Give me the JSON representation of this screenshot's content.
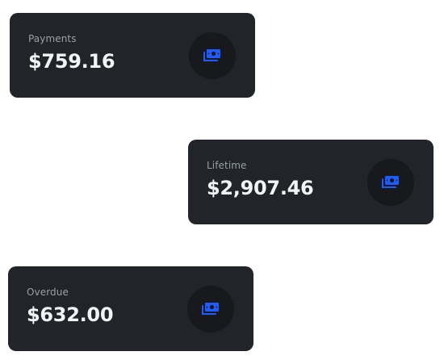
{
  "accent": "#1f5cff",
  "cards": [
    {
      "label": "Payments",
      "value": "$759.16",
      "icon": "money-icon"
    },
    {
      "label": "Lifetime",
      "value": "$2,907.46",
      "icon": "money-icon"
    },
    {
      "label": "Overdue",
      "value": "$632.00",
      "icon": "money-icon"
    }
  ]
}
